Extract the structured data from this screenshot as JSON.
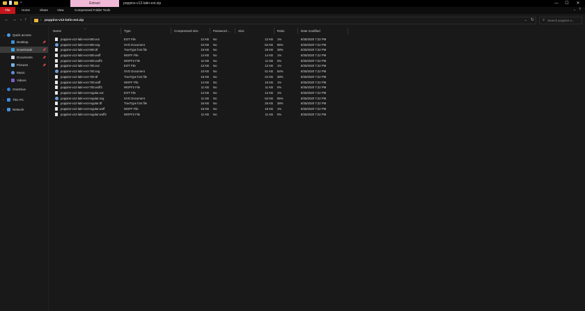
{
  "titlebar": {
    "context_tab": "Extract",
    "title": "poppins-v12-latin-ext.zip",
    "minimize": "—",
    "maximize": "☐",
    "close": "✕"
  },
  "ribbon": {
    "tabs": [
      "File",
      "Home",
      "Share",
      "View",
      "Compressed Folder Tools"
    ],
    "collapse": "⌄",
    "help": "?"
  },
  "address": {
    "back": "←",
    "forward": "→",
    "recent": "⌄",
    "up": "↑",
    "chevron": "›",
    "path": "poppins-v12-latin-ext.zip",
    "dropdown": "⌄",
    "refresh": "↻"
  },
  "search": {
    "placeholder": "Search poppins-v..."
  },
  "nav": {
    "quick_access": "Quick access",
    "desktop": "Desktop",
    "downloads": "Downloads",
    "documents": "Documents",
    "pictures": "Pictures",
    "music": "Music",
    "videos": "Videos",
    "onedrive": "OneDrive",
    "this_pc": "This PC",
    "network": "Network",
    "pin": "📌"
  },
  "columns": {
    "name": "Name",
    "type": "Type",
    "compressed": "Compressed size",
    "password": "Password ...",
    "size": "Size",
    "ratio": "Ratio",
    "date": "Date modified"
  },
  "files": [
    {
      "name": "poppins-v12-latin-ext-500.eot",
      "type": "EOT File",
      "compressed": "12 KB",
      "password": "No",
      "size": "12 KB",
      "ratio": "1%",
      "date": "8/25/2020 7:22 PM",
      "icon": "file-icon"
    },
    {
      "name": "poppins-v12-latin-ext-500.svg",
      "type": "SVG Document",
      "compressed": "10 KB",
      "password": "No",
      "size": "52 KB",
      "ratio": "85%",
      "date": "8/25/2020 7:22 PM",
      "icon": "svg-file-icon"
    },
    {
      "name": "poppins-v12-latin-ext-500.ttf",
      "type": "TrueType font file",
      "compressed": "15 KB",
      "password": "No",
      "size": "25 KB",
      "ratio": "38%",
      "date": "8/25/2020 7:22 PM",
      "icon": "file-icon"
    },
    {
      "name": "poppins-v12-latin-ext-500.woff",
      "type": "WOFF File",
      "compressed": "14 KB",
      "password": "No",
      "size": "14 KB",
      "ratio": "1%",
      "date": "8/25/2020 7:22 PM",
      "icon": "file-icon"
    },
    {
      "name": "poppins-v12-latin-ext-500.woff2",
      "type": "WOFF2 File",
      "compressed": "11 KB",
      "password": "No",
      "size": "11 KB",
      "ratio": "0%",
      "date": "8/25/2020 7:22 PM",
      "icon": "file-icon"
    },
    {
      "name": "poppins-v12-latin-ext-700.eot",
      "type": "EOT File",
      "compressed": "12 KB",
      "password": "No",
      "size": "12 KB",
      "ratio": "1%",
      "date": "8/25/2020 7:22 PM",
      "icon": "file-icon"
    },
    {
      "name": "poppins-v12-latin-ext-700.svg",
      "type": "SVG Document",
      "compressed": "10 KB",
      "password": "No",
      "size": "51 KB",
      "ratio": "84%",
      "date": "8/25/2020 7:22 PM",
      "icon": "svg-file-icon"
    },
    {
      "name": "poppins-v12-latin-ext-700.ttf",
      "type": "TrueType font file",
      "compressed": "15 KB",
      "password": "No",
      "size": "24 KB",
      "ratio": "38%",
      "date": "8/25/2020 7:22 PM",
      "icon": "file-icon"
    },
    {
      "name": "poppins-v12-latin-ext-700.woff",
      "type": "WOFF File",
      "compressed": "14 KB",
      "password": "No",
      "size": "15 KB",
      "ratio": "1%",
      "date": "8/25/2020 7:22 PM",
      "icon": "file-icon"
    },
    {
      "name": "poppins-v12-latin-ext-700.woff2",
      "type": "WOFF2 File",
      "compressed": "11 KB",
      "password": "No",
      "size": "11 KB",
      "ratio": "0%",
      "date": "8/25/2020 7:22 PM",
      "icon": "file-icon"
    },
    {
      "name": "poppins-v12-latin-ext-regular.eot",
      "type": "EOT File",
      "compressed": "12 KB",
      "password": "No",
      "size": "12 KB",
      "ratio": "1%",
      "date": "8/25/2020 7:22 PM",
      "icon": "file-icon"
    },
    {
      "name": "poppins-v12-latin-ext-regular.svg",
      "type": "SVG Document",
      "compressed": "11 KB",
      "password": "No",
      "size": "52 KB",
      "ratio": "85%",
      "date": "8/25/2020 7:22 PM",
      "icon": "svg-file-icon"
    },
    {
      "name": "poppins-v12-latin-ext-regular.ttf",
      "type": "TrueType font file",
      "compressed": "16 KB",
      "password": "No",
      "size": "25 KB",
      "ratio": "38%",
      "date": "8/25/2020 7:22 PM",
      "icon": "file-icon"
    },
    {
      "name": "poppins-v12-latin-ext-regular.woff",
      "type": "WOFF File",
      "compressed": "15 KB",
      "password": "No",
      "size": "15 KB",
      "ratio": "1%",
      "date": "8/25/2020 7:22 PM",
      "icon": "file-icon"
    },
    {
      "name": "poppins-v12-latin-ext-regular.woff2",
      "type": "WOFF2 File",
      "compressed": "11 KB",
      "password": "No",
      "size": "11 KB",
      "ratio": "0%",
      "date": "8/25/2020 7:22 PM",
      "icon": "file-icon"
    }
  ],
  "colors": {
    "file_tab": "#c4161c",
    "context_tab": "#f2b8d7",
    "folder": "#e8b83a",
    "background": "#191919"
  }
}
